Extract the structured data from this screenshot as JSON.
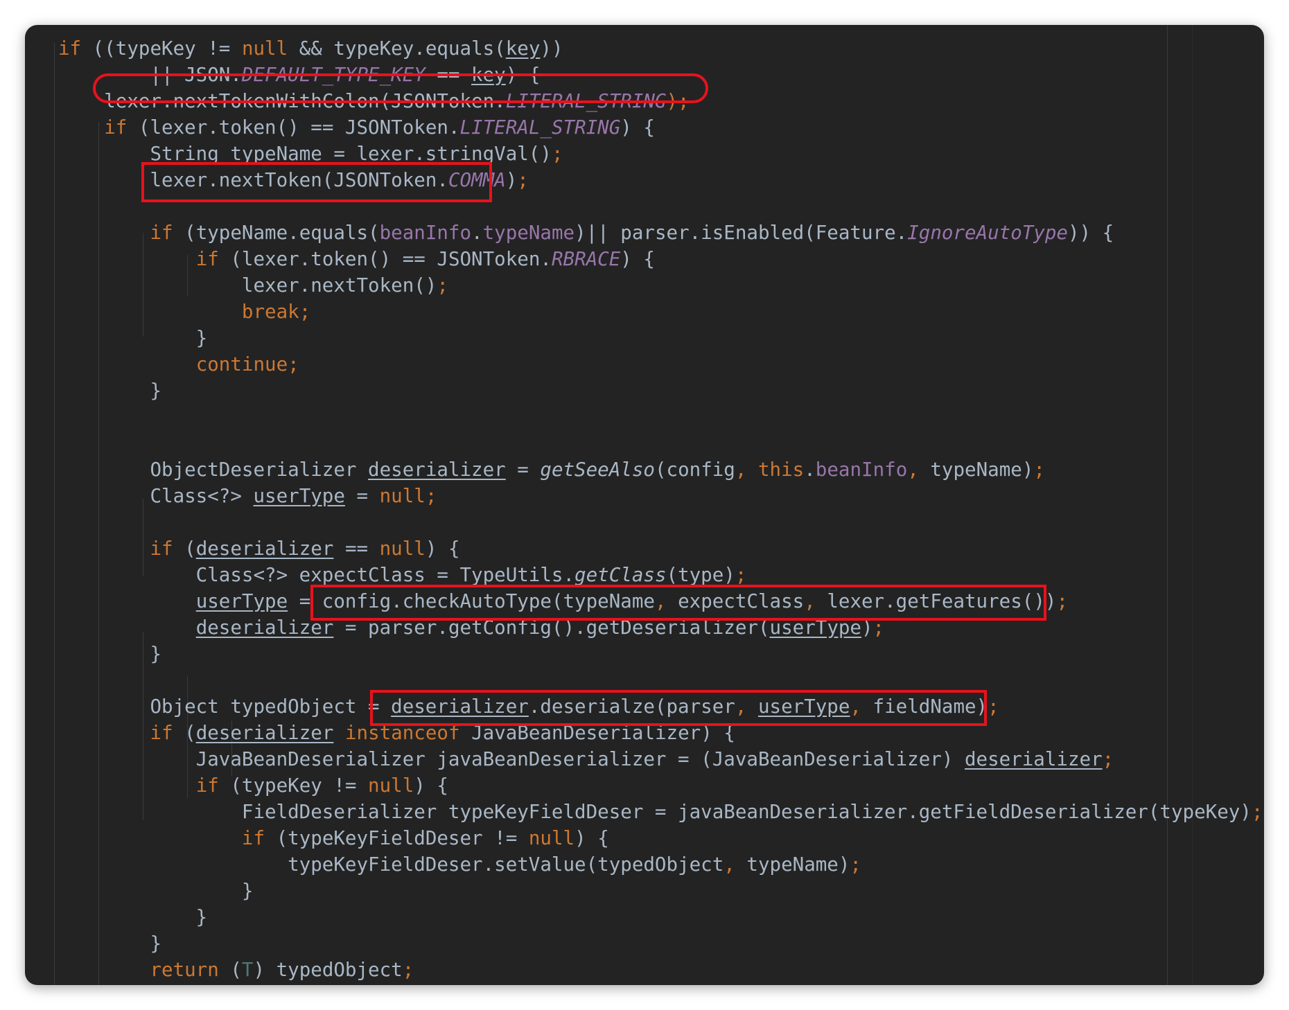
{
  "editor": {
    "theme_colors": {
      "background": "#232323",
      "default_text": "#a9b7c6",
      "keyword": "#cc7832",
      "constant": "#9876aa",
      "highlight_box": "#e8121c"
    },
    "lines": [
      [
        {
          "t": "if",
          "c": "kw"
        },
        {
          "t": " ((typeKey "
        },
        {
          "t": "!="
        },
        {
          "t": " "
        },
        {
          "t": "null",
          "c": "kw"
        },
        {
          "t": " && typeKey.equals("
        },
        {
          "t": "key",
          "c": "u"
        },
        {
          "t": "))"
        }
      ],
      [
        {
          "t": "        || JSON."
        },
        {
          "t": "DEFAULT_TYPE_KEY",
          "c": "con"
        },
        {
          "t": " == "
        },
        {
          "t": "key",
          "c": "u"
        },
        {
          "t": ") {"
        }
      ],
      [
        {
          "t": "    lexer.nextTokenWithColon(JSONToken."
        },
        {
          "t": "LITERAL_STRING",
          "c": "con"
        },
        {
          "t": ");",
          "c": "pu"
        }
      ],
      [
        {
          "t": "    "
        },
        {
          "t": "if",
          "c": "kw"
        },
        {
          "t": " (lexer.token() == JSONToken."
        },
        {
          "t": "LITERAL_STRING",
          "c": "con"
        },
        {
          "t": ") {"
        }
      ],
      [
        {
          "t": "        String typeName = lexer.stringVal()"
        },
        {
          "t": ";",
          "c": "pu"
        }
      ],
      [
        {
          "t": "        lexer.nextToken(JSONToken."
        },
        {
          "t": "COMMA",
          "c": "con"
        },
        {
          "t": ")"
        },
        {
          "t": ";",
          "c": "pu"
        }
      ],
      [],
      [
        {
          "t": "        "
        },
        {
          "t": "if",
          "c": "kw"
        },
        {
          "t": " (typeName.equals("
        },
        {
          "t": "beanInfo",
          "c": "fld"
        },
        {
          "t": "."
        },
        {
          "t": "typeName",
          "c": "fld"
        },
        {
          "t": ")|| parser.isEnabled(Feature."
        },
        {
          "t": "IgnoreAutoType",
          "c": "con"
        },
        {
          "t": ")) {"
        }
      ],
      [
        {
          "t": "            "
        },
        {
          "t": "if",
          "c": "kw"
        },
        {
          "t": " (lexer.token() == JSONToken."
        },
        {
          "t": "RBRACE",
          "c": "con"
        },
        {
          "t": ") {"
        }
      ],
      [
        {
          "t": "                lexer.nextToken()"
        },
        {
          "t": ";",
          "c": "pu"
        }
      ],
      [
        {
          "t": "                "
        },
        {
          "t": "break;",
          "c": "kw"
        }
      ],
      [
        {
          "t": "            }"
        }
      ],
      [
        {
          "t": "            "
        },
        {
          "t": "continue;",
          "c": "kw"
        }
      ],
      [
        {
          "t": "        }"
        }
      ],
      [],
      [],
      [
        {
          "t": "        ObjectDeserializer "
        },
        {
          "t": "deserializer",
          "c": "u"
        },
        {
          "t": " = "
        },
        {
          "t": "getSeeAlso",
          "c": "sta"
        },
        {
          "t": "(config"
        },
        {
          "t": ", ",
          "c": "pu"
        },
        {
          "t": "this",
          "c": "kw"
        },
        {
          "t": "."
        },
        {
          "t": "beanInfo",
          "c": "fld"
        },
        {
          "t": ", ",
          "c": "pu"
        },
        {
          "t": "typeName)"
        },
        {
          "t": ";",
          "c": "pu"
        }
      ],
      [
        {
          "t": "        Class<?> "
        },
        {
          "t": "userType",
          "c": "u"
        },
        {
          "t": " = "
        },
        {
          "t": "null;",
          "c": "kw"
        }
      ],
      [],
      [
        {
          "t": "        "
        },
        {
          "t": "if",
          "c": "kw"
        },
        {
          "t": " ("
        },
        {
          "t": "deserializer",
          "c": "u"
        },
        {
          "t": " == "
        },
        {
          "t": "null",
          "c": "kw"
        },
        {
          "t": ") {"
        }
      ],
      [
        {
          "t": "            Class<?> expectClass = TypeUtils."
        },
        {
          "t": "getClass",
          "c": "sta"
        },
        {
          "t": "(type)"
        },
        {
          "t": ";",
          "c": "pu"
        }
      ],
      [
        {
          "t": "            "
        },
        {
          "t": "userType",
          "c": "u"
        },
        {
          "t": " = config.checkAutoType(typeName"
        },
        {
          "t": ", ",
          "c": "pu"
        },
        {
          "t": "expectClass"
        },
        {
          "t": ", ",
          "c": "pu"
        },
        {
          "t": "lexer.getFeatures())"
        },
        {
          "t": ";",
          "c": "pu"
        }
      ],
      [
        {
          "t": "            "
        },
        {
          "t": "deserializer",
          "c": "u"
        },
        {
          "t": " = parser.getConfig().getDeserializer("
        },
        {
          "t": "userType",
          "c": "u"
        },
        {
          "t": ")"
        },
        {
          "t": ";",
          "c": "pu"
        }
      ],
      [
        {
          "t": "        }"
        }
      ],
      [],
      [
        {
          "t": "        Object typedObject = "
        },
        {
          "t": "deserializer",
          "c": "u"
        },
        {
          "t": ".deserialze(parser"
        },
        {
          "t": ", ",
          "c": "pu"
        },
        {
          "t": "userType",
          "c": "u"
        },
        {
          "t": ", ",
          "c": "pu"
        },
        {
          "t": "fieldName)"
        },
        {
          "t": ";",
          "c": "pu"
        }
      ],
      [
        {
          "t": "        "
        },
        {
          "t": "if",
          "c": "kw"
        },
        {
          "t": " ("
        },
        {
          "t": "deserializer",
          "c": "u"
        },
        {
          "t": " "
        },
        {
          "t": "instanceof",
          "c": "kw"
        },
        {
          "t": " JavaBeanDeserializer) {"
        }
      ],
      [
        {
          "t": "            JavaBeanDeserializer javaBeanDeserializer = (JavaBeanDeserializer) "
        },
        {
          "t": "deserializer",
          "c": "u"
        },
        {
          "t": ";",
          "c": "pu"
        }
      ],
      [
        {
          "t": "            "
        },
        {
          "t": "if",
          "c": "kw"
        },
        {
          "t": " (typeKey != "
        },
        {
          "t": "null",
          "c": "kw"
        },
        {
          "t": ") {"
        }
      ],
      [
        {
          "t": "                FieldDeserializer typeKeyFieldDeser = javaBeanDeserializer.getFieldDeserializer(typeKey)"
        },
        {
          "t": ";",
          "c": "pu"
        }
      ],
      [
        {
          "t": "                "
        },
        {
          "t": "if",
          "c": "kw"
        },
        {
          "t": " (typeKeyFieldDeser != "
        },
        {
          "t": "null",
          "c": "kw"
        },
        {
          "t": ") {"
        }
      ],
      [
        {
          "t": "                    typeKeyFieldDeser.setValue(typedObject"
        },
        {
          "t": ", ",
          "c": "pu"
        },
        {
          "t": "typeName)"
        },
        {
          "t": ";",
          "c": "pu"
        }
      ],
      [
        {
          "t": "                }"
        }
      ],
      [
        {
          "t": "            }"
        }
      ],
      [
        {
          "t": "        }"
        }
      ],
      [
        {
          "t": "        "
        },
        {
          "t": "return",
          "c": "kw"
        },
        {
          "t": " ("
        },
        {
          "t": "T",
          "c": "tp"
        },
        {
          "t": ") typedObject"
        },
        {
          "t": ";",
          "c": "pu"
        }
      ]
    ]
  }
}
